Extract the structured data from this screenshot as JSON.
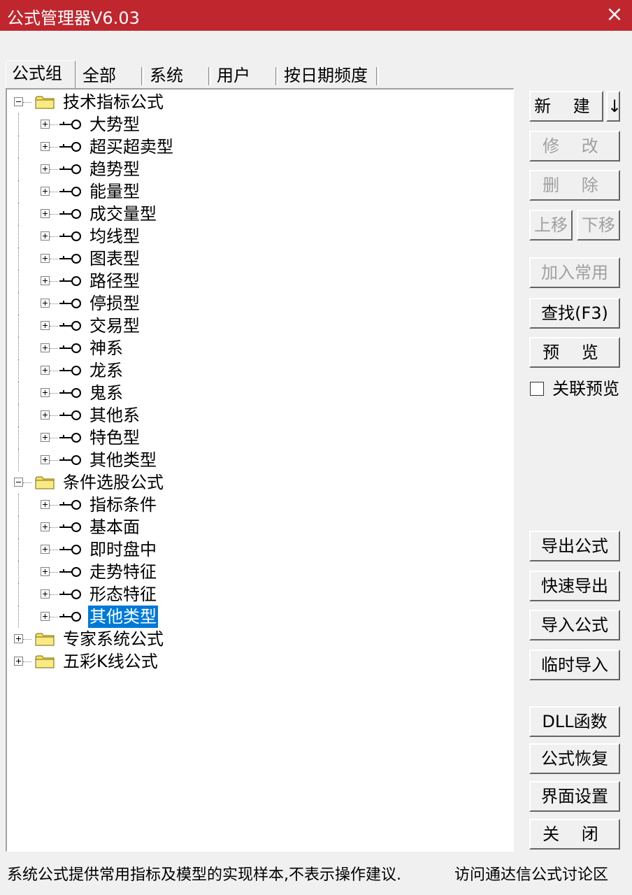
{
  "window": {
    "title": "公式管理器V6.03",
    "close_glyph": "×"
  },
  "tabs": [
    "公式组",
    "全部",
    "系统",
    "用户",
    "按日期频度"
  ],
  "tree": {
    "groups": [
      {
        "label": "技术指标公式",
        "expanded": true,
        "children": [
          "大势型",
          "超买超卖型",
          "趋势型",
          "能量型",
          "成交量型",
          "均线型",
          "图表型",
          "路径型",
          "停损型",
          "交易型",
          "神系",
          "龙系",
          "鬼系",
          "其他系",
          "特色型",
          "其他类型"
        ]
      },
      {
        "label": "条件选股公式",
        "expanded": true,
        "children": [
          "指标条件",
          "基本面",
          "即时盘中",
          "走势特征",
          "形态特征",
          "其他类型"
        ],
        "selected_child": 5
      },
      {
        "label": "专家系统公式",
        "expanded": false,
        "children": []
      },
      {
        "label": "五彩K线公式",
        "expanded": false,
        "children": []
      }
    ]
  },
  "buttons": {
    "new": "新 建",
    "new_arrow": "↓",
    "edit": "修 改",
    "delete": "删 除",
    "move_up": "上移",
    "move_down": "下移",
    "add_common": "加入常用",
    "find": "查找(F3)",
    "preview": "预 览",
    "export": "导出公式",
    "quick_export": "快速导出",
    "import": "导入公式",
    "temp_import": "临时导入",
    "dll": "DLL函数",
    "restore": "公式恢复",
    "ui_settings": "界面设置",
    "close": "关 闭"
  },
  "link_preview": {
    "label": "关联预览",
    "checked": false
  },
  "status": {
    "left": "系统公式提供常用指标及模型的实现样本,不表示操作建议.",
    "right": "访问通达信公式讨论区"
  },
  "colors": {
    "titlebar": "#c0262e",
    "selection": "#0078d7",
    "folder": "#f5e06a"
  }
}
